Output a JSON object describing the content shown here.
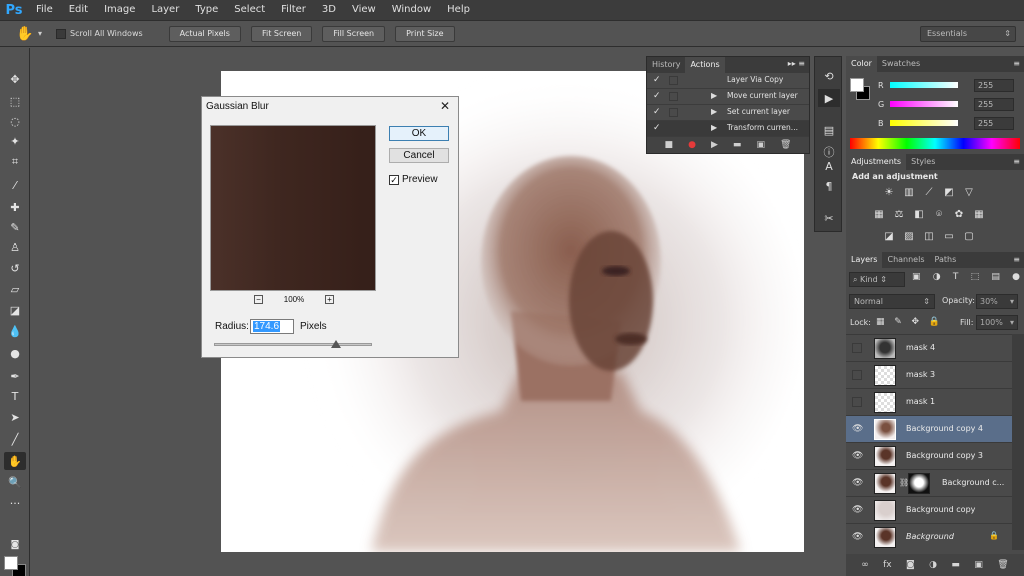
{
  "app": {
    "logo": "Ps"
  },
  "menu": [
    "File",
    "Edit",
    "Image",
    "Layer",
    "Type",
    "Select",
    "Filter",
    "3D",
    "View",
    "Window",
    "Help"
  ],
  "options": {
    "scroll_all_windows": "Scroll All Windows",
    "buttons": [
      "Actual Pixels",
      "Fit Screen",
      "Fill Screen",
      "Print Size"
    ],
    "workspace": "Essentials"
  },
  "dialog": {
    "title": "Gaussian Blur",
    "ok": "OK",
    "cancel": "Cancel",
    "preview": "Preview",
    "zoom": "100%",
    "radius_label": "Radius:",
    "radius_value": "174.6",
    "radius_unit": "Pixels"
  },
  "actions_panel": {
    "tabs": [
      "History",
      "Actions"
    ],
    "items": [
      "Layer Via Copy",
      "Move current layer",
      "Set current layer",
      "Transform curren..."
    ]
  },
  "color_panel": {
    "tabs": [
      "Color",
      "Swatches"
    ],
    "channels": [
      {
        "label": "R",
        "value": "255"
      },
      {
        "label": "G",
        "value": "255"
      },
      {
        "label": "B",
        "value": "255"
      }
    ]
  },
  "adjustments_panel": {
    "tabs": [
      "Adjustments",
      "Styles"
    ],
    "title": "Add an adjustment"
  },
  "layers_panel": {
    "tabs": [
      "Layers",
      "Channels",
      "Paths"
    ],
    "kind": "Kind",
    "blend_mode": "Normal",
    "opacity_label": "Opacity:",
    "opacity_value": "30%",
    "lock_label": "Lock:",
    "fill_label": "Fill:",
    "fill_value": "100%",
    "layers": [
      {
        "name": "mask 4"
      },
      {
        "name": "mask 3"
      },
      {
        "name": "mask 1"
      },
      {
        "name": "Background copy 4"
      },
      {
        "name": "Background copy 3"
      },
      {
        "name": "Background c..."
      },
      {
        "name": "Background copy"
      },
      {
        "name": "Background"
      }
    ]
  }
}
